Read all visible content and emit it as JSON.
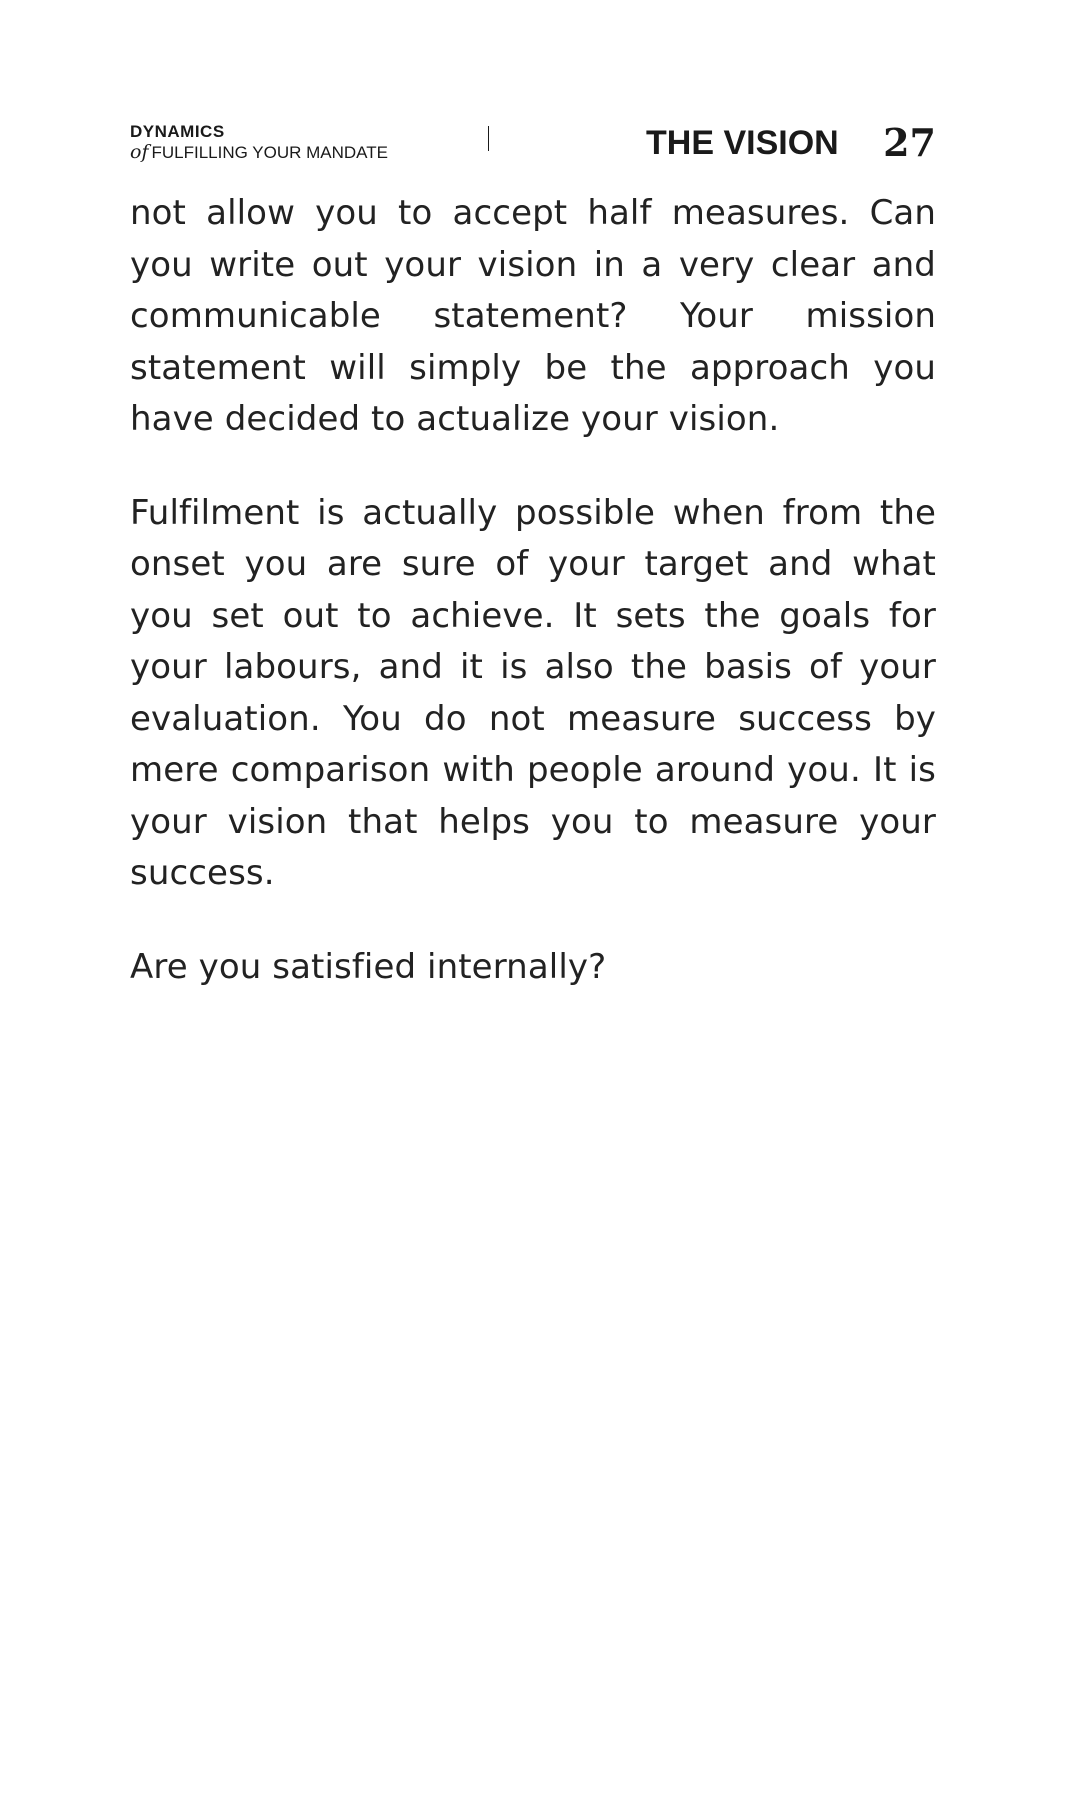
{
  "header": {
    "book_title_line1": "DYNAMICS",
    "book_title_of": "of",
    "book_title_line2": "FULFILLING YOUR MANDATE",
    "chapter_title": "THE VISION",
    "page_number": "27"
  },
  "body": {
    "paragraphs": [
      "not allow you to accept half measures. Can you write out your vision in a very clear and communicable statement? Your mission statement will simply be the approach you have decided to actualize your vision.",
      "Fulfilment is actually possible when from the onset you are sure of your target and what you set out to achieve. It sets the goals for your labours, and it is also the basis of your evaluation. You do not measure success by mere comparison with people around you. It is your vision that helps you to measure your success.",
      "Are you satisfied internally?"
    ]
  }
}
